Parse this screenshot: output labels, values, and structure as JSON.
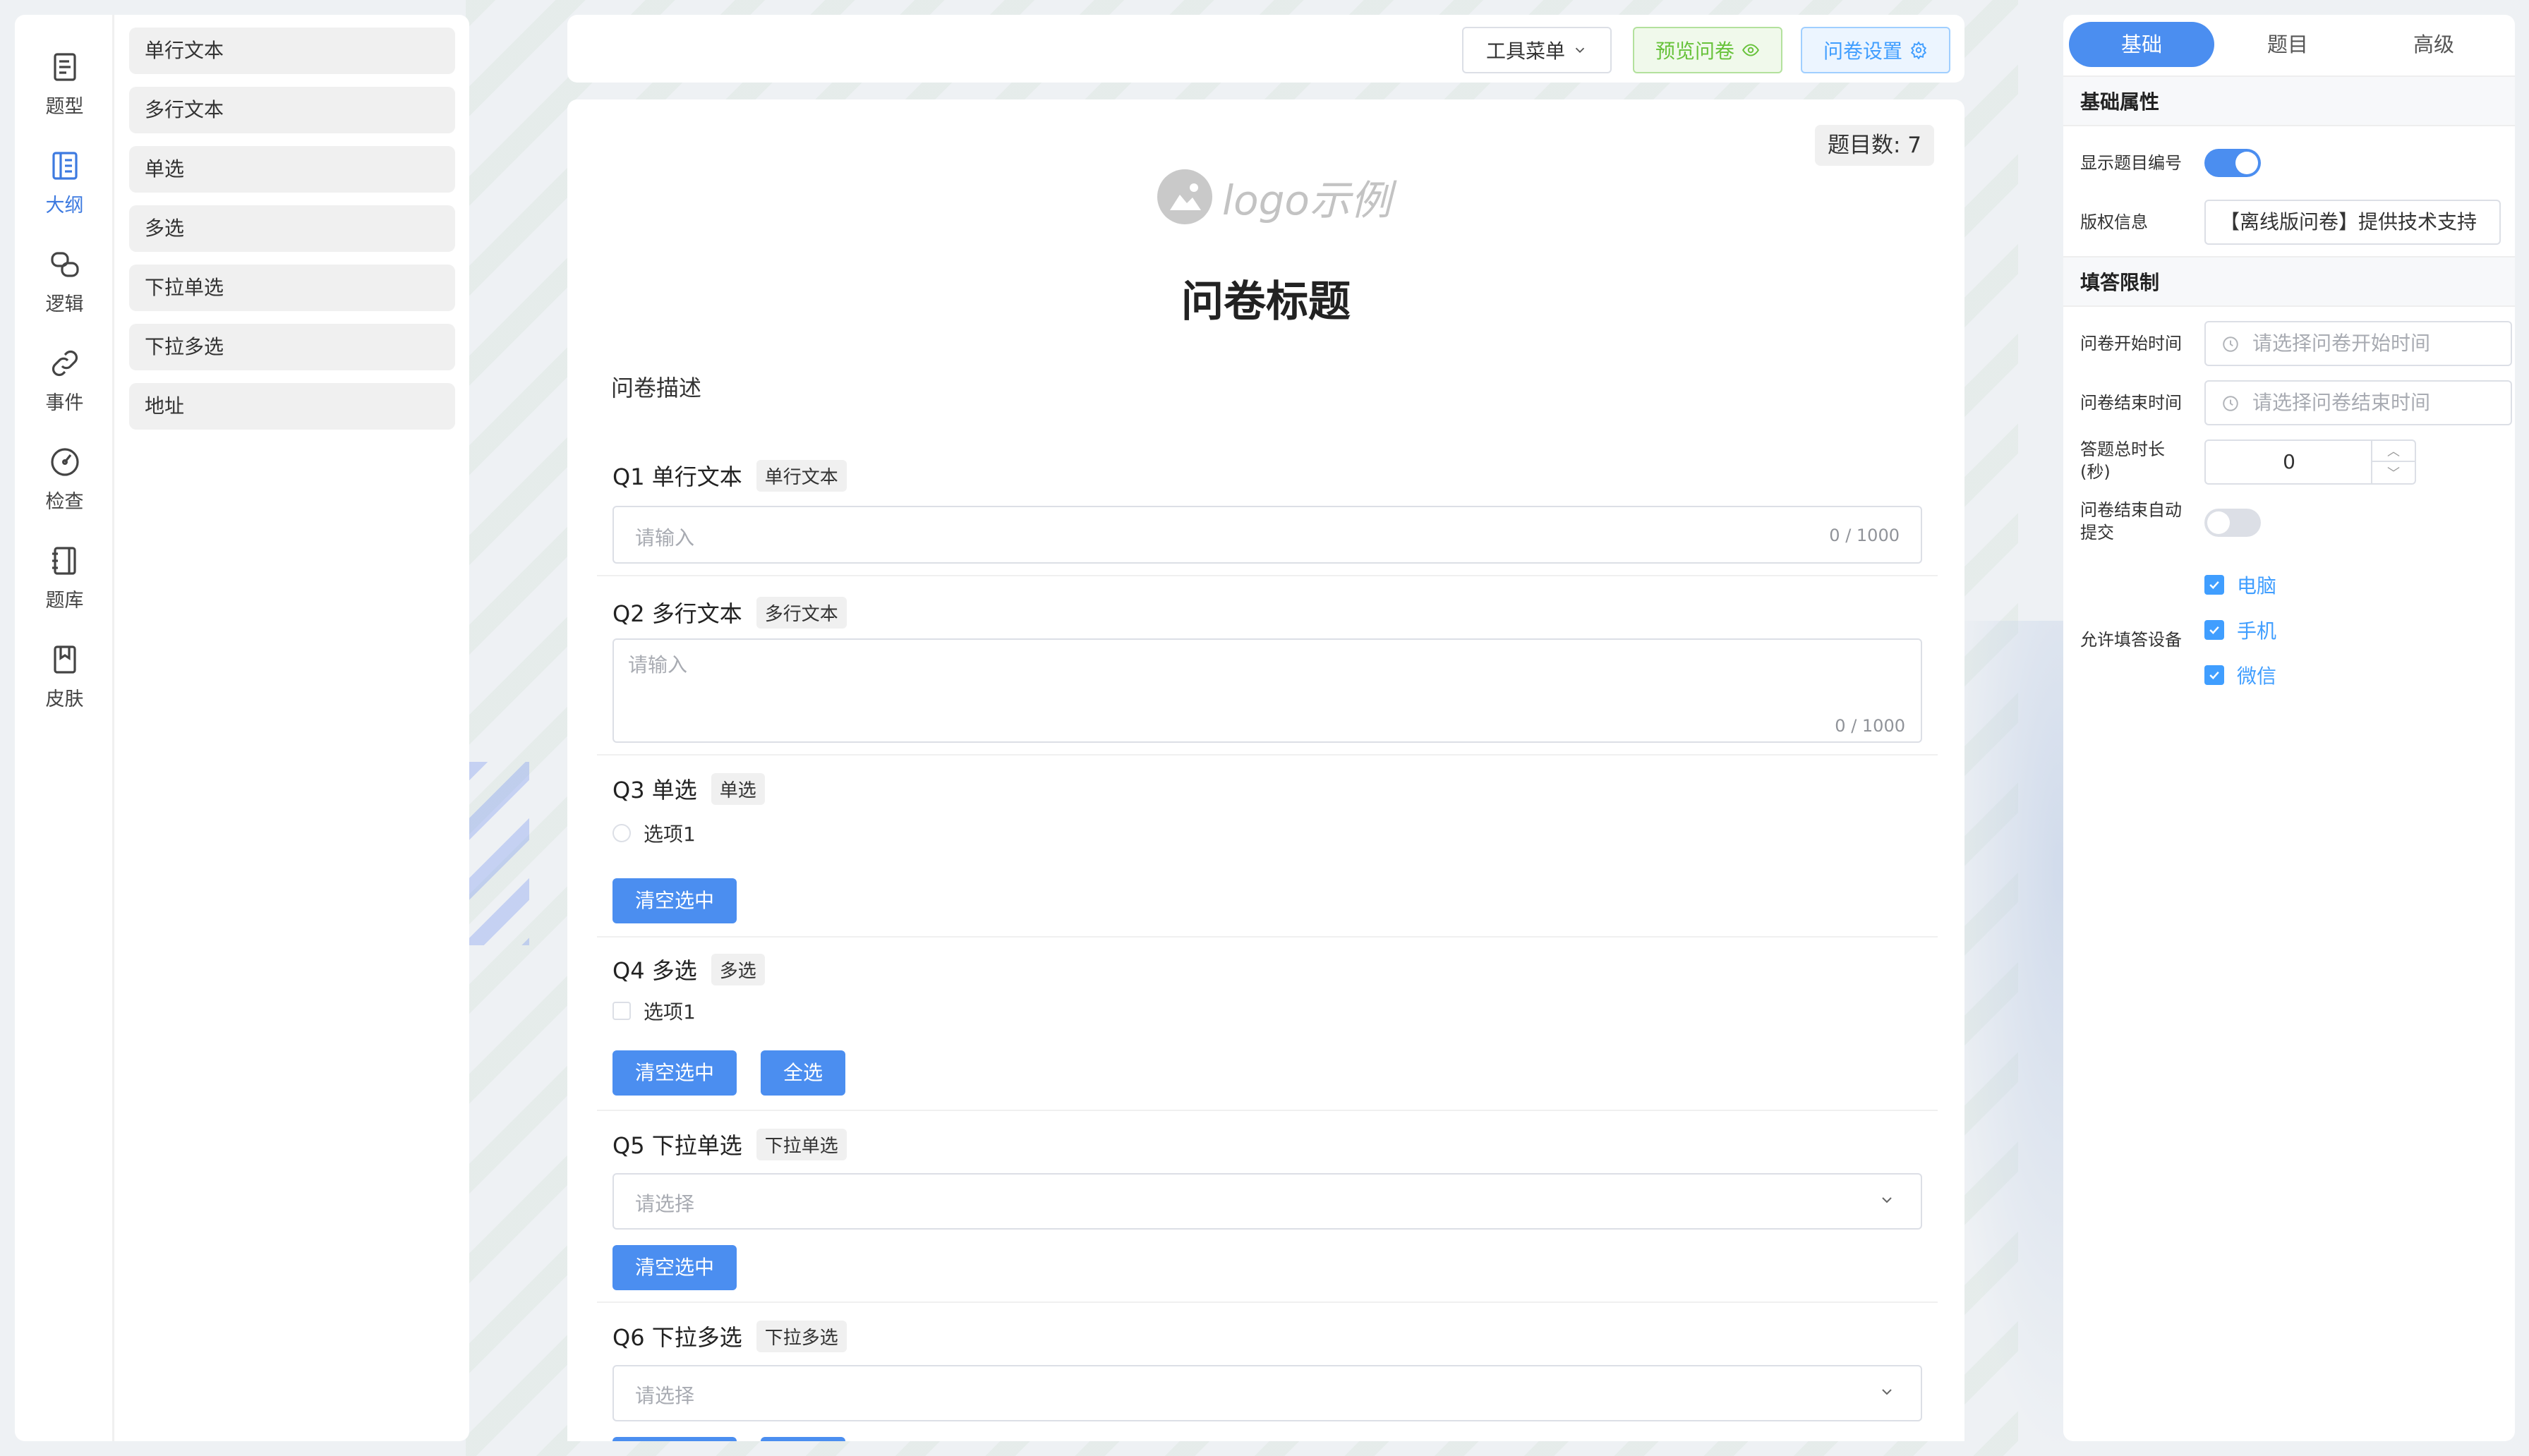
{
  "nav": {
    "items": [
      {
        "label": "题型",
        "icon": "document-icon"
      },
      {
        "label": "大纲",
        "icon": "outline-icon"
      },
      {
        "label": "逻辑",
        "icon": "logic-icon"
      },
      {
        "label": "事件",
        "icon": "link-icon"
      },
      {
        "label": "检查",
        "icon": "gauge-icon"
      },
      {
        "label": "题库",
        "icon": "notebook-icon"
      },
      {
        "label": "皮肤",
        "icon": "bookmark-icon"
      }
    ],
    "active_index": 1,
    "accent": "#3d7ae0"
  },
  "question_types": [
    "单行文本",
    "多行文本",
    "单选",
    "多选",
    "下拉单选",
    "下拉多选",
    "地址"
  ],
  "toolbar": {
    "tools_label": "工具菜单",
    "preview_label": "预览问卷",
    "settings_label": "问卷设置"
  },
  "survey": {
    "count_label": "题目数: 7",
    "logo_text": "logo示例",
    "title": "问卷标题",
    "description": "问卷描述",
    "questions": [
      {
        "head": "Q1 单行文本",
        "tag": "单行文本",
        "placeholder": "请输入",
        "counter": "0 / 1000"
      },
      {
        "head": "Q2 多行文本",
        "tag": "多行文本",
        "placeholder": "请输入",
        "counter": "0 / 1000"
      },
      {
        "head": "Q3 单选",
        "tag": "单选",
        "option": "选项1",
        "btn_clear": "清空选中"
      },
      {
        "head": "Q4 多选",
        "tag": "多选",
        "option": "选项1",
        "btn_clear": "清空选中",
        "btn_all": "全选"
      },
      {
        "head": "Q5 下拉单选",
        "tag": "下拉单选",
        "placeholder": "请选择",
        "btn_clear": "清空选中"
      },
      {
        "head": "Q6 下拉多选",
        "tag": "下拉多选",
        "placeholder": "请选择"
      }
    ]
  },
  "settings": {
    "tabs": [
      "基础",
      "题目",
      "高级"
    ],
    "active_tab": 0,
    "section_basic": "基础属性",
    "show_number_label": "显示题目编号",
    "show_number_on": true,
    "copyright_label": "版权信息",
    "copyright_value": "【离线版问卷】提供技术支持",
    "section_limit": "填答限制",
    "start_label": "问卷开始时间",
    "start_placeholder": "请选择问卷开始时间",
    "end_label": "问卷结束时间",
    "end_placeholder": "请选择问卷结束时间",
    "duration_label_1": "答题总时长",
    "duration_label_2": "(秒)",
    "duration_value": "0",
    "auto_submit_label_1": "问卷结束自动",
    "auto_submit_label_2": "提交",
    "auto_submit_on": false,
    "devices_label": "允许填答设备",
    "devices": [
      "电脑",
      "手机",
      "微信"
    ]
  }
}
